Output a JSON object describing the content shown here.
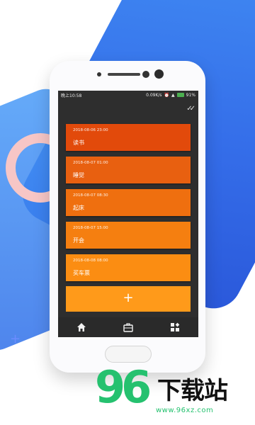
{
  "status_bar": {
    "time": "晚上10:58",
    "speed": "0.09K/s",
    "battery": "91%"
  },
  "toolbar": {
    "action_icon": "done-all-icon"
  },
  "tasks": [
    {
      "date": "2018-08-06 23:00",
      "title": "读书",
      "color": "#e24a0b"
    },
    {
      "date": "2018-08-07 01:00",
      "title": "睡觉",
      "color": "#e86010"
    },
    {
      "date": "2018-08-07 08:30",
      "title": "起床",
      "color": "#ef6f0f"
    },
    {
      "date": "2018-08-07 15:00",
      "title": "开会",
      "color": "#f57f10"
    },
    {
      "date": "2018-08-08 08:00",
      "title": "买车票",
      "color": "#fb8d12"
    }
  ],
  "add_button": {
    "label": "+"
  },
  "bottom_nav": [
    {
      "icon": "home-icon"
    },
    {
      "icon": "briefcase-icon"
    },
    {
      "icon": "widgets-icon"
    }
  ],
  "watermark": {
    "number": "96",
    "text": "下载站",
    "url": "www.96xz.com"
  }
}
